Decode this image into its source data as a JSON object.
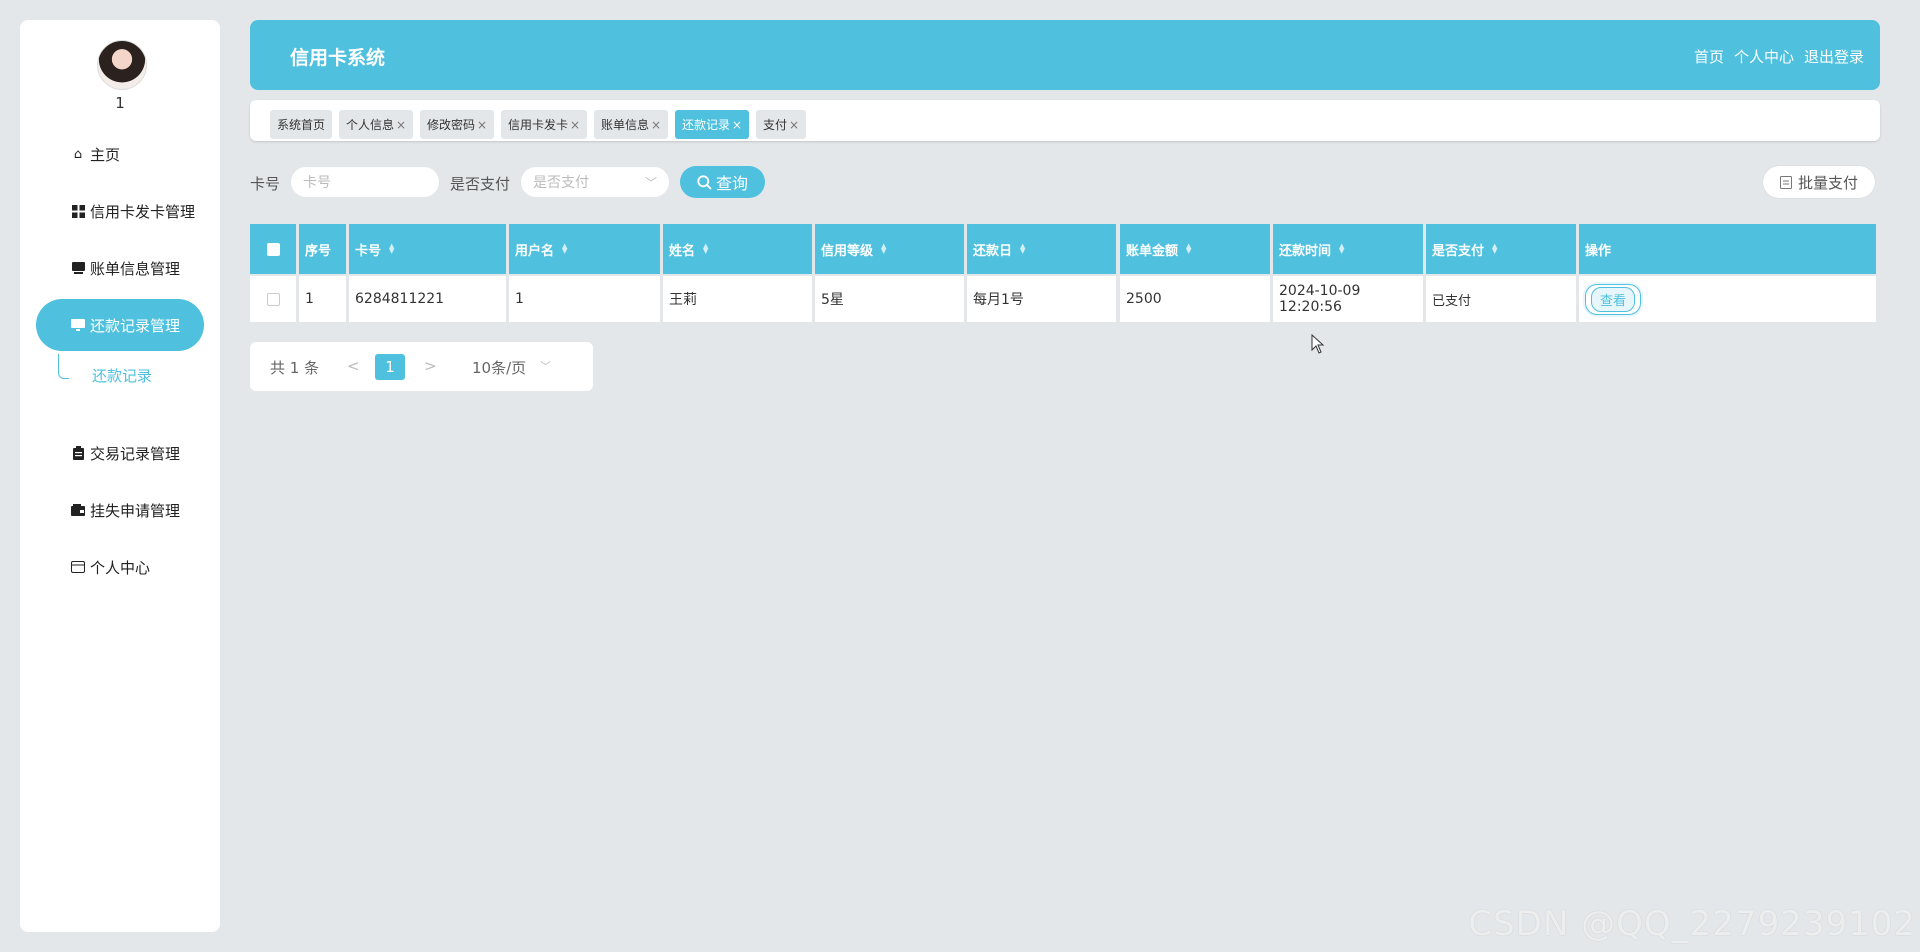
{
  "sidebar": {
    "username": "1",
    "items": [
      {
        "label": "主页",
        "icon": "home-icon"
      },
      {
        "label": "信用卡发卡管理",
        "icon": "grid-icon"
      },
      {
        "label": "账单信息管理",
        "icon": "bill-icon"
      },
      {
        "label": "还款记录管理",
        "icon": "monitor-icon"
      },
      {
        "label": "交易记录管理",
        "icon": "clipboard-icon"
      },
      {
        "label": "挂失申请管理",
        "icon": "wallet-icon"
      },
      {
        "label": "个人中心",
        "icon": "card-icon"
      }
    ],
    "subitem": "还款记录"
  },
  "header": {
    "title": "信用卡系统",
    "links": [
      "首页",
      "个人中心",
      "退出登录"
    ]
  },
  "tabs": [
    {
      "label": "系统首页"
    },
    {
      "label": "个人信息"
    },
    {
      "label": "修改密码"
    },
    {
      "label": "信用卡发卡"
    },
    {
      "label": "账单信息"
    },
    {
      "label": "还款记录"
    },
    {
      "label": "支付"
    }
  ],
  "search": {
    "card_label": "卡号",
    "card_placeholder": "卡号",
    "paid_label": "是否支付",
    "paid_placeholder": "是否支付",
    "query_button": "查询",
    "batch_button": "批量支付"
  },
  "table": {
    "headers": [
      "序号",
      "卡号",
      "用户名",
      "姓名",
      "信用等级",
      "还款日",
      "账单金额",
      "还款时间",
      "是否支付",
      "操作"
    ],
    "rows": [
      {
        "index": "1",
        "card": "6284811221",
        "username": "1",
        "name": "王莉",
        "level": "5星",
        "due": "每月1号",
        "amount": "2500",
        "time": "2024-10-09 12:20:56",
        "paid": "已支付",
        "action": "查看"
      }
    ]
  },
  "pagination": {
    "total": "共 1 条",
    "prev": "<",
    "page": "1",
    "next": ">",
    "size": "10条/页"
  },
  "watermark": "CSDN @QQ_2279239102",
  "colors": {
    "accent": "#4fc0de",
    "background": "#e4e7ea"
  }
}
